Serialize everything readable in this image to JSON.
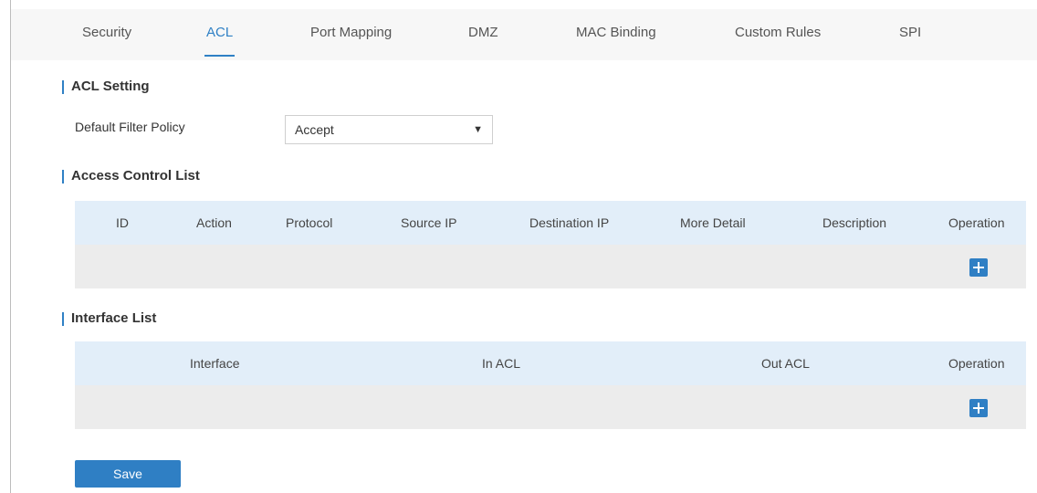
{
  "tabs": [
    {
      "label": "Security",
      "active": false
    },
    {
      "label": "ACL",
      "active": true
    },
    {
      "label": "Port Mapping",
      "active": false
    },
    {
      "label": "DMZ",
      "active": false
    },
    {
      "label": "MAC Binding",
      "active": false
    },
    {
      "label": "Custom Rules",
      "active": false
    },
    {
      "label": "SPI",
      "active": false
    }
  ],
  "acl_setting": {
    "title": "ACL Setting",
    "default_filter_policy_label": "Default Filter Policy",
    "default_filter_policy_value": "Accept"
  },
  "access_control_list": {
    "title": "Access Control List",
    "columns": [
      "ID",
      "Action",
      "Protocol",
      "Source IP",
      "Destination IP",
      "More Detail",
      "Description",
      "Operation"
    ],
    "rows": []
  },
  "interface_list": {
    "title": "Interface List",
    "columns": [
      "Interface",
      "In ACL",
      "Out ACL",
      "Operation"
    ],
    "rows": []
  },
  "save_label": "Save",
  "colors": {
    "accent": "#2f80c5",
    "header_bg": "#e2eef9",
    "row_bg": "#ececec",
    "tabbar_bg": "#f7f7f7"
  },
  "icons": {
    "add": "plus-icon",
    "select_caret": "caret-down-icon"
  }
}
